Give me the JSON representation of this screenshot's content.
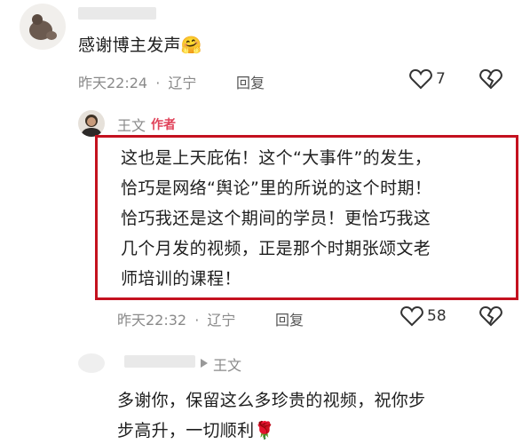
{
  "comment1": {
    "text": "感谢博主发声",
    "emoji": "🤗",
    "time": "昨天22:24",
    "location": "辽宁",
    "reply_label": "回复",
    "likes": "7"
  },
  "reply": {
    "author": "王文",
    "author_tag": "作者",
    "lines": [
      "这也是上天庇佑！这个“大事件”的发生，",
      "恰巧是网络“舆论”里的所说的这个时期！",
      "恰巧我还是这个期间的学员！更恰巧我这",
      "几个月发的视频，正是那个时期张颂文老",
      "师培训的课程！"
    ],
    "time": "昨天22:32",
    "location": "辽宁",
    "reply_label": "回复",
    "likes": "58"
  },
  "comment3": {
    "reply_to": "王文",
    "lines": [
      "多谢你，保留这么多珍贵的视频，祝你步",
      "步高升，一切顺利"
    ],
    "emoji": "🌹"
  },
  "colors": {
    "highlight_border": "#c4111f",
    "author_tag": "#e0435a"
  },
  "icons": [
    "heart-outline-icon",
    "broken-heart-icon",
    "reply-arrow-icon"
  ]
}
